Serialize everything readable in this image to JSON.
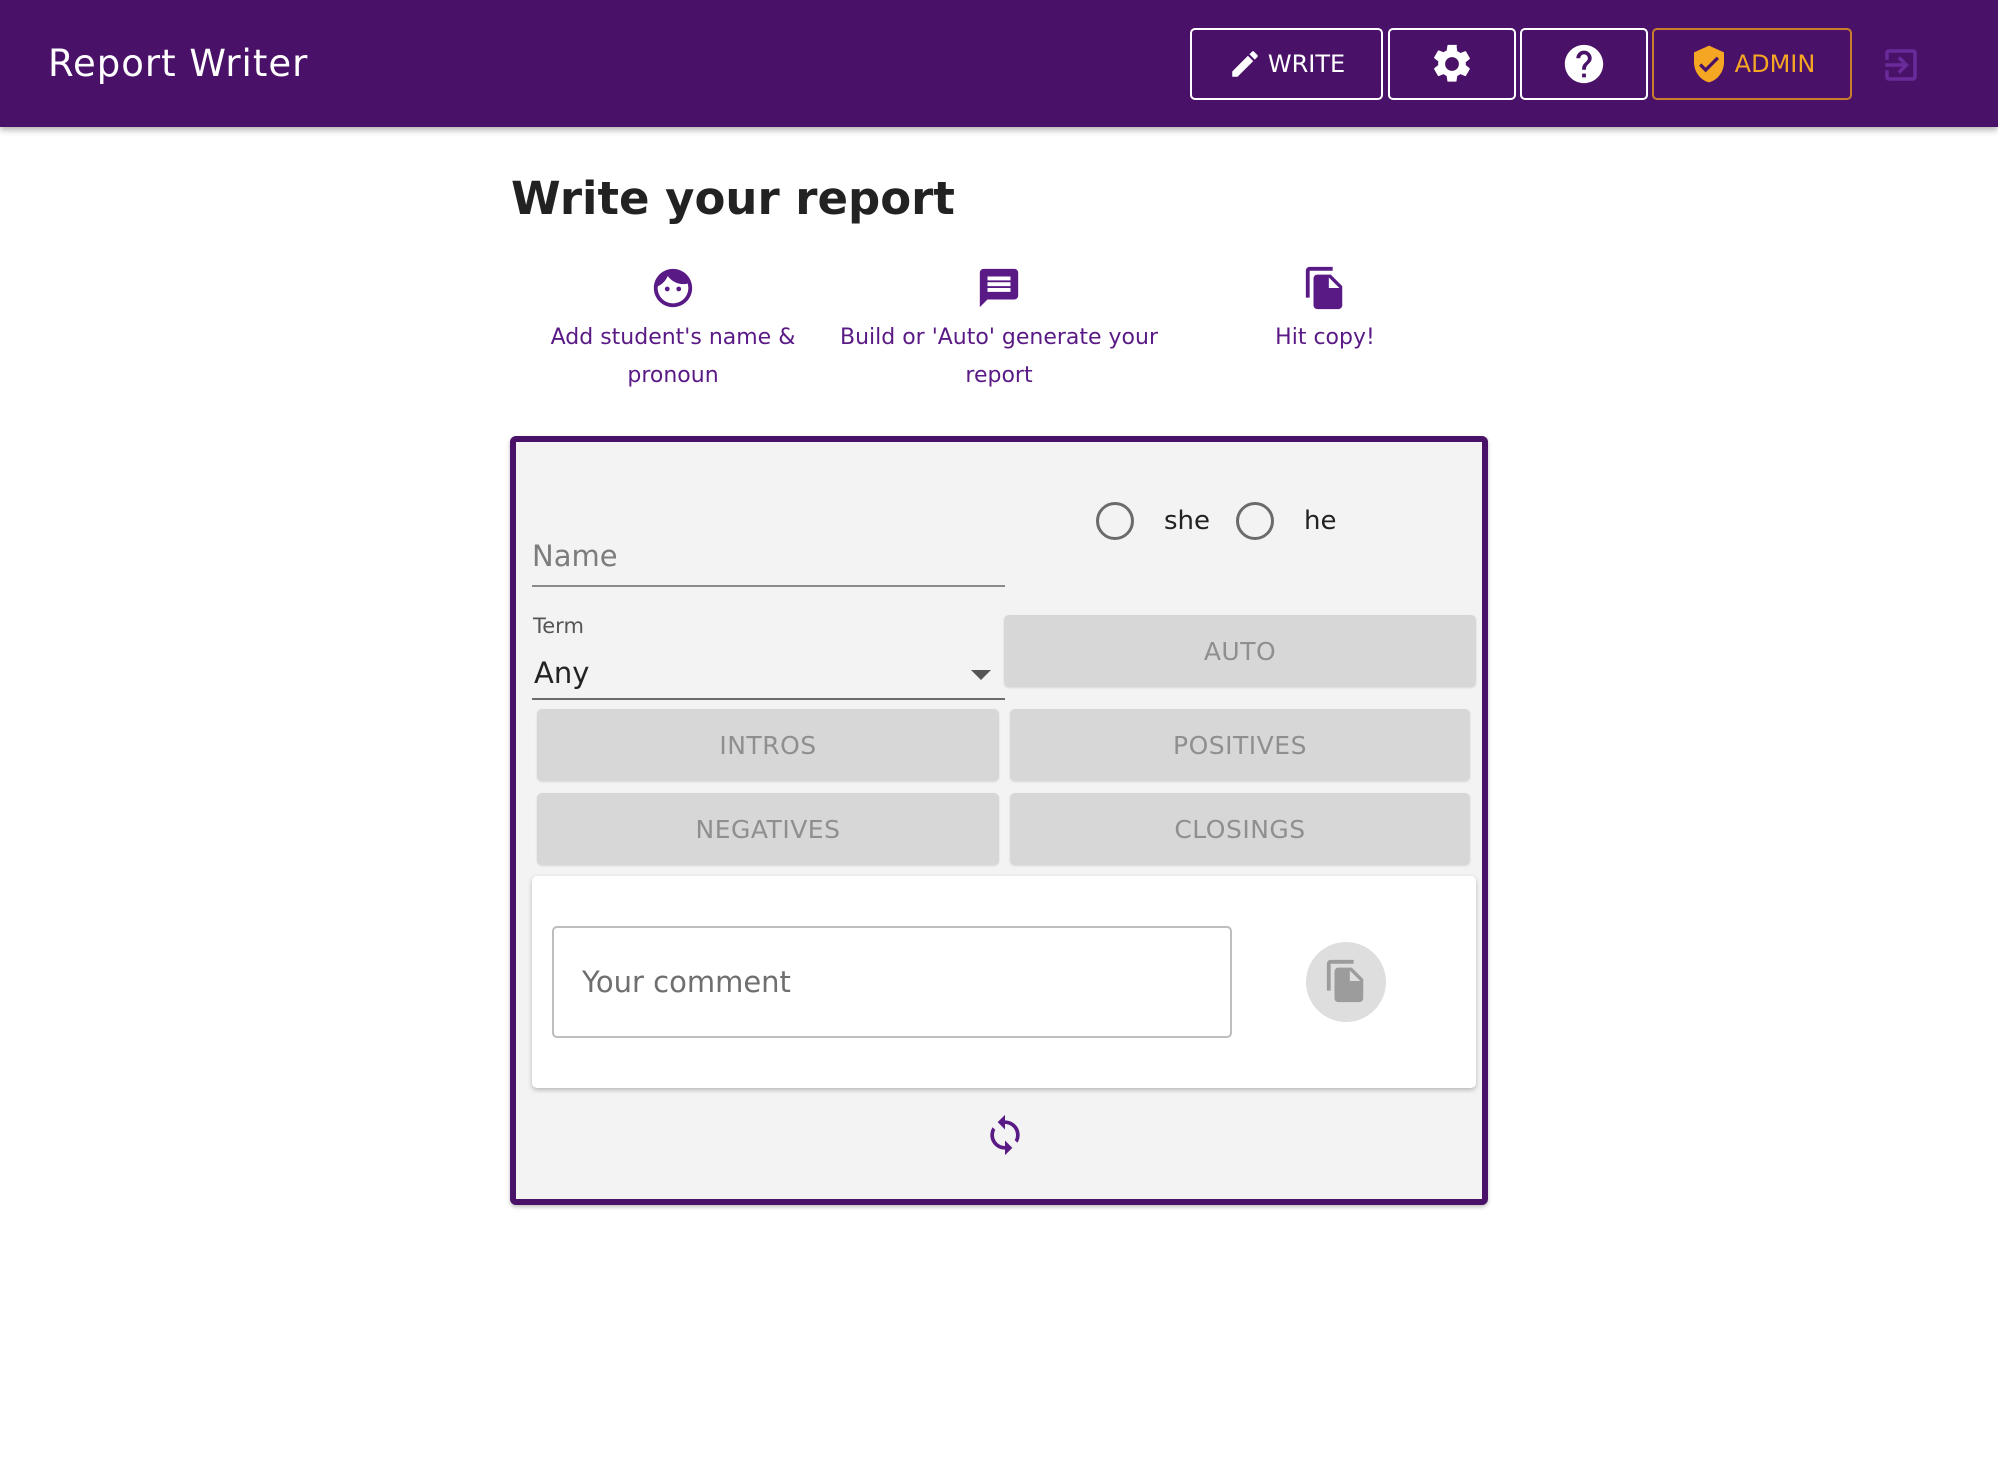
{
  "app": {
    "title": "Report Writer"
  },
  "nav": {
    "write_label": "WRITE",
    "admin_label": "ADMIN",
    "icons": [
      "pencil-icon",
      "gear-icon",
      "help-icon",
      "shield-check-icon",
      "logout-icon"
    ]
  },
  "page": {
    "heading": "Write your report"
  },
  "steps": [
    {
      "icon": "face-icon",
      "label": "Add student's name & pronoun"
    },
    {
      "icon": "comment-icon",
      "label": "Build or 'Auto' generate your report"
    },
    {
      "icon": "copy-icon",
      "label": "Hit copy!"
    }
  ],
  "form": {
    "name_placeholder": "Name",
    "name_value": "",
    "pronouns": [
      {
        "label": "she",
        "selected": false
      },
      {
        "label": "he",
        "selected": false
      }
    ],
    "term_label": "Term",
    "term_value": "Any",
    "buttons": {
      "auto": "AUTO",
      "intros": "INTROS",
      "positives": "POSITIVES",
      "negatives": "NEGATIVES",
      "closings": "CLOSINGS"
    },
    "comment_placeholder": "Your comment",
    "comment_value": ""
  },
  "colors": {
    "brand": "#4a1168",
    "accent_text": "#5a1a86",
    "admin": "#f5a623",
    "disabled_button": "#d7d7d7"
  }
}
